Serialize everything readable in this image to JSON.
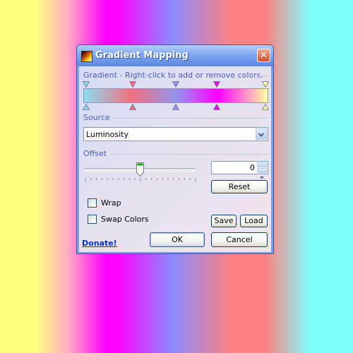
{
  "window": {
    "title": "Gradient Mapping",
    "close_glyph": "✕",
    "icon": "gradient-app-icon"
  },
  "gradient": {
    "label": "Gradient - Right-click to add or remove colors.",
    "stops": [
      {
        "position": 0.0,
        "color": "#8cdcf0"
      },
      {
        "position": 0.26,
        "color": "#f07080"
      },
      {
        "position": 0.5,
        "color": "#9494f0"
      },
      {
        "position": 0.73,
        "color": "#ff00ff"
      },
      {
        "position": 1.0,
        "color": "#ffffa0"
      }
    ]
  },
  "source": {
    "label": "Source",
    "selected": "Luminosity"
  },
  "offset": {
    "label": "Offset",
    "value": "0",
    "slider_fraction": 0.5,
    "reset_label": "Reset"
  },
  "options": {
    "wrap_label": "Wrap",
    "wrap_checked": false,
    "swap_label": "Swap Colors",
    "swap_checked": false
  },
  "buttons": {
    "save": "Save",
    "load": "Load",
    "ok": "OK",
    "cancel": "Cancel"
  },
  "donate": "Donate!",
  "colors": {
    "title_bar": "#7fa7f0",
    "accent_label": "#4a5bc0",
    "link": "#0033cc",
    "close_button": "#d9512c"
  }
}
